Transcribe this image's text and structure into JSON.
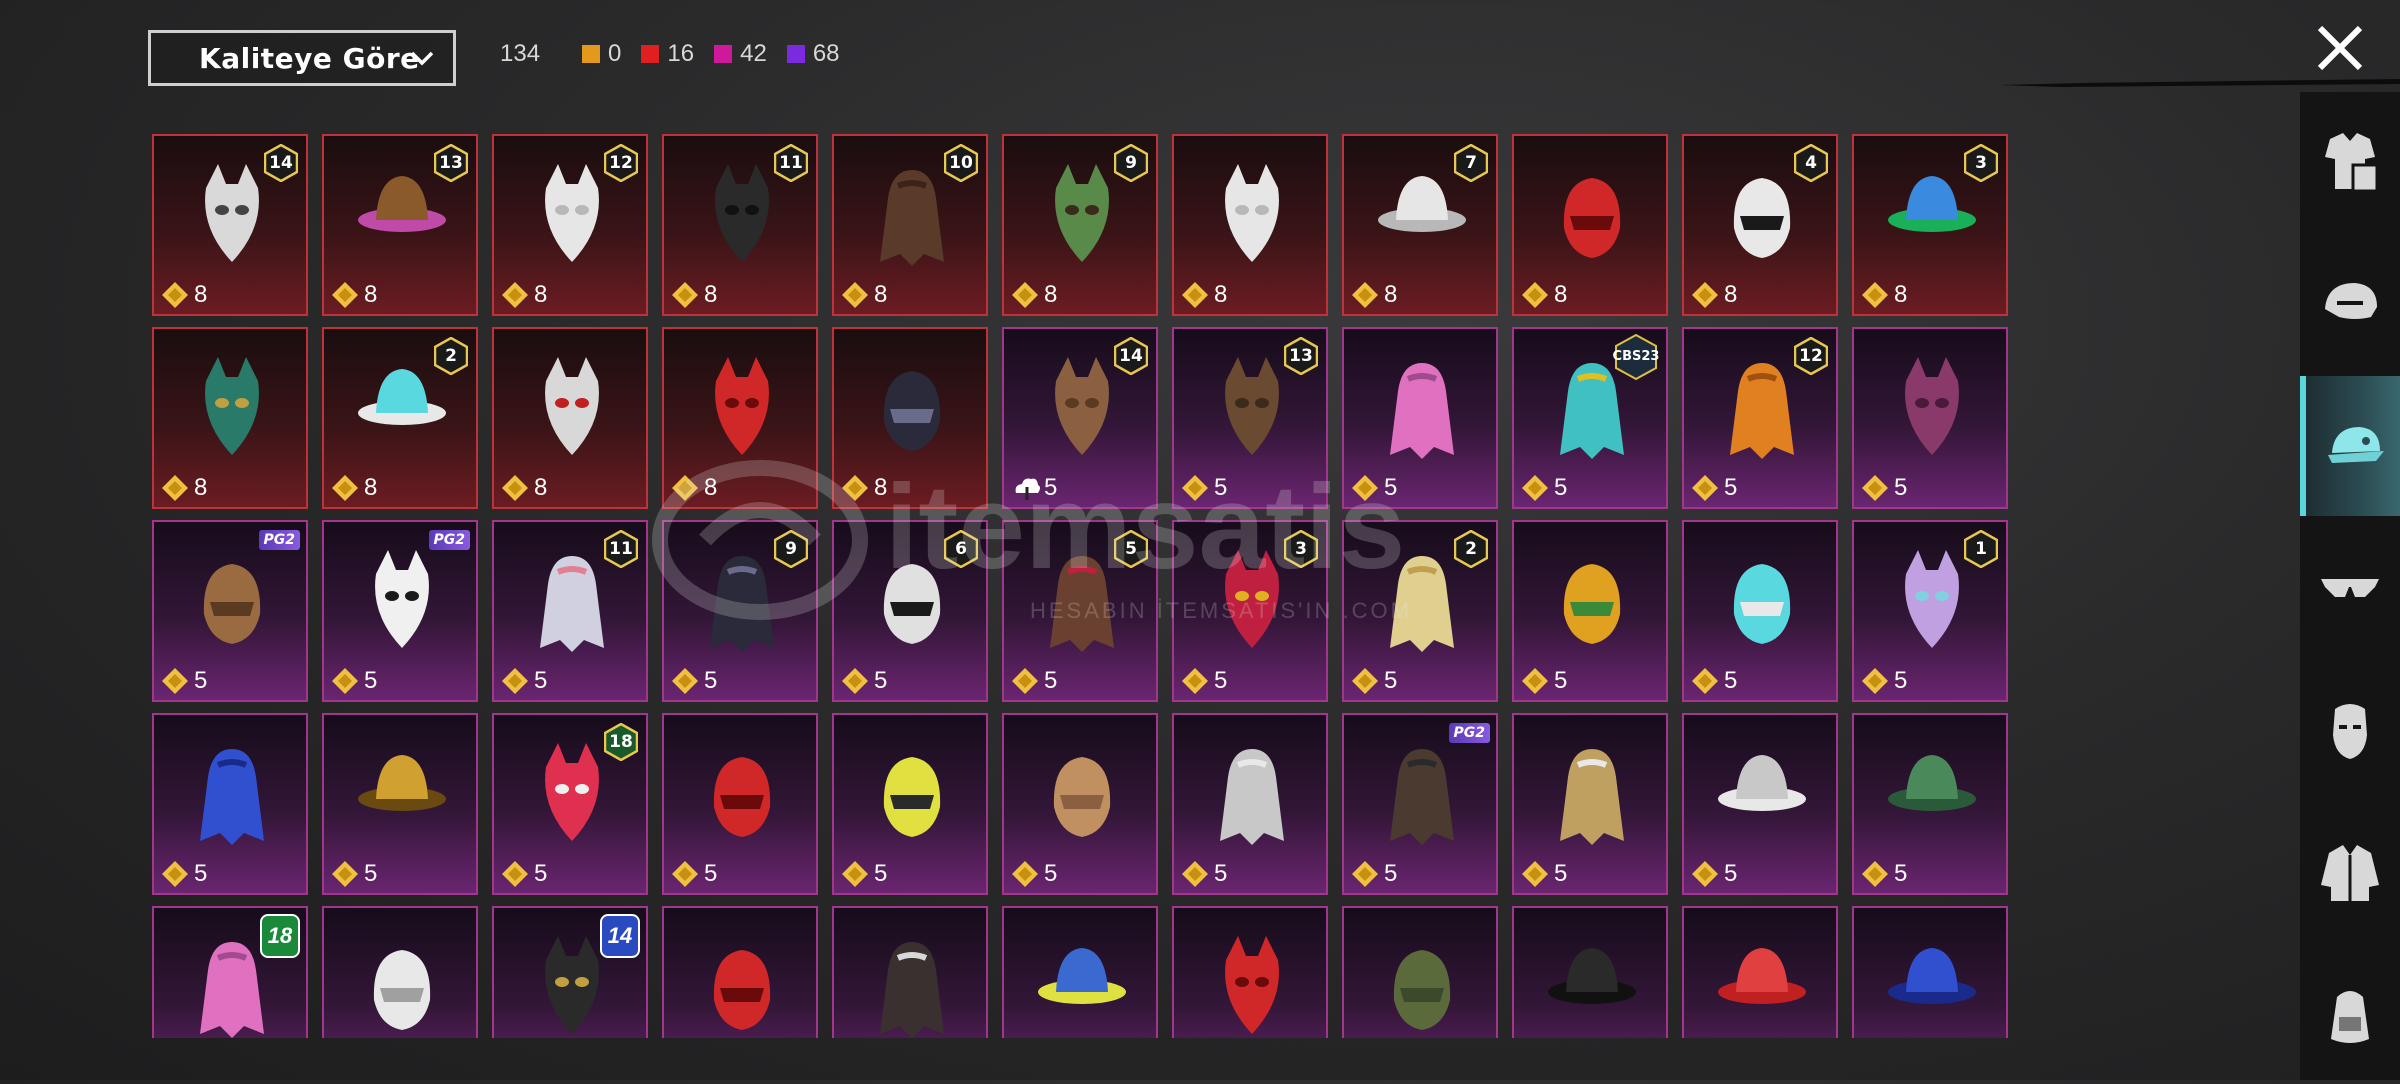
{
  "header": {
    "sort_label": "Kaliteye Göre",
    "total_count": "134",
    "quality_counts": [
      {
        "value": "0",
        "color": "#e39a1c"
      },
      {
        "value": "16",
        "color": "#e02020"
      },
      {
        "value": "42",
        "color": "#d0189a"
      },
      {
        "value": "68",
        "color": "#7b2ae0"
      }
    ],
    "close_icon": "close-icon"
  },
  "sidebar": {
    "tabs": [
      {
        "name": "clothing-icon",
        "active": false
      },
      {
        "name": "hat-mask-icon",
        "active": false
      },
      {
        "name": "cap-icon",
        "active": true
      },
      {
        "name": "glasses-icon",
        "active": false
      },
      {
        "name": "face-icon",
        "active": false
      },
      {
        "name": "jacket-icon",
        "active": false
      },
      {
        "name": "backpack-icon",
        "active": false
      }
    ]
  },
  "watermark": {
    "brand": "itemsatis",
    "tagline": "HESABIN İTEMSATIS'IN .COM"
  },
  "grid": {
    "rows": [
      [
        {
          "rarity": "red",
          "badge": "14",
          "points": "8",
          "icon": "wolf-mask-icon"
        },
        {
          "rarity": "red",
          "badge": "13",
          "points": "8",
          "icon": "flower-hat-hair-icon"
        },
        {
          "rarity": "red",
          "badge": "12",
          "points": "8",
          "icon": "white-hair-bow-icon"
        },
        {
          "rarity": "red",
          "badge": "11",
          "points": "8",
          "icon": "black-helmet-icon"
        },
        {
          "rarity": "red",
          "badge": "10",
          "points": "8",
          "icon": "braided-hair-icon"
        },
        {
          "rarity": "red",
          "badge": "9",
          "points": "8",
          "icon": "zombie-head-icon"
        },
        {
          "rarity": "red",
          "badge": "",
          "points": "8",
          "icon": "white-cowboy-hat-icon"
        },
        {
          "rarity": "red",
          "badge": "7",
          "points": "8",
          "icon": "white-hair-icon"
        },
        {
          "rarity": "red",
          "badge": "",
          "points": "8",
          "icon": "red-helmet-icon"
        },
        {
          "rarity": "red",
          "badge": "4",
          "points": "8",
          "icon": "snowman-hat-icon"
        },
        {
          "rarity": "red",
          "badge": "3",
          "points": "8",
          "icon": "joker-mask-icon"
        }
      ],
      [
        {
          "rarity": "red",
          "badge": "",
          "points": "8",
          "icon": "dragon-helmet-icon"
        },
        {
          "rarity": "red",
          "badge": "2",
          "points": "8",
          "icon": "cyan-bucket-hat-icon"
        },
        {
          "rarity": "red",
          "badge": "",
          "points": "8",
          "icon": "oni-mask-icon"
        },
        {
          "rarity": "red",
          "badge": "",
          "points": "8",
          "icon": "red-visor-helmet-icon"
        },
        {
          "rarity": "red",
          "badge": "",
          "points": "8",
          "icon": "dark-horned-helmet-icon"
        },
        {
          "rarity": "purple",
          "badge": "14",
          "points": "5",
          "icon": "brown-hair-flower-icon",
          "cloud": true
        },
        {
          "rarity": "purple",
          "badge": "13",
          "points": "5",
          "icon": "aviator-cap-icon"
        },
        {
          "rarity": "purple",
          "badge": "",
          "points": "5",
          "icon": "pink-pigtails-icon"
        },
        {
          "rarity": "purple",
          "badge": "CBS23",
          "points": "5",
          "icon": "cat-headphones-icon"
        },
        {
          "rarity": "purple",
          "badge": "12",
          "points": "5",
          "icon": "orange-twintails-icon"
        },
        {
          "rarity": "purple",
          "badge": "",
          "points": "5",
          "icon": "horned-hood-icon"
        }
      ],
      [
        {
          "rarity": "purple",
          "badge": "PG2",
          "points": "5",
          "icon": "bear-mask-icon"
        },
        {
          "rarity": "purple",
          "badge": "PG2",
          "points": "5",
          "icon": "panda-mask-icon"
        },
        {
          "rarity": "purple",
          "badge": "11",
          "points": "5",
          "icon": "veil-headband-icon"
        },
        {
          "rarity": "purple",
          "badge": "9",
          "points": "5",
          "icon": "dark-long-hair-icon"
        },
        {
          "rarity": "purple",
          "badge": "6",
          "points": "5",
          "icon": "knight-helmet-icon"
        },
        {
          "rarity": "purple",
          "badge": "5",
          "points": "5",
          "icon": "bow-pigtails-icon"
        },
        {
          "rarity": "purple",
          "badge": "3",
          "points": "5",
          "icon": "jester-hat-icon"
        },
        {
          "rarity": "purple",
          "badge": "2",
          "points": "5",
          "icon": "blonde-bandana-icon"
        },
        {
          "rarity": "purple",
          "badge": "",
          "points": "5",
          "icon": "feather-headdress-icon"
        },
        {
          "rarity": "purple",
          "badge": "",
          "points": "5",
          "icon": "cyan-mohawk-icon"
        },
        {
          "rarity": "purple",
          "badge": "1",
          "points": "5",
          "icon": "pastel-twintails-icon"
        }
      ],
      [
        {
          "rarity": "purple",
          "badge": "",
          "points": "5",
          "icon": "blue-wolf-mask-icon"
        },
        {
          "rarity": "purple",
          "badge": "",
          "points": "5",
          "icon": "gold-helmet-icon"
        },
        {
          "rarity": "purple",
          "badge": "18",
          "points": "5",
          "icon": "uncle-sam-hat-icon"
        },
        {
          "rarity": "purple",
          "badge": "",
          "points": "5",
          "icon": "red-cap-hair-icon"
        },
        {
          "rarity": "purple",
          "badge": "",
          "points": "5",
          "icon": "yellow-bucket-hat-icon"
        },
        {
          "rarity": "purple",
          "badge": "",
          "points": "5",
          "icon": "straw-hat-icon"
        },
        {
          "rarity": "purple",
          "badge": "",
          "points": "5",
          "icon": "silver-hood-icon"
        },
        {
          "rarity": "purple",
          "badge": "PG2",
          "points": "5",
          "icon": "gas-mask-icon"
        },
        {
          "rarity": "purple",
          "badge": "",
          "points": "5",
          "icon": "feathered-crown-icon"
        },
        {
          "rarity": "purple",
          "badge": "",
          "points": "5",
          "icon": "silver-ponytail-icon"
        },
        {
          "rarity": "purple",
          "badge": "",
          "points": "5",
          "icon": "green-hood-icon"
        }
      ],
      [
        {
          "rarity": "purple",
          "badge": "18",
          "points": "",
          "icon": "pink-headphones-icon"
        },
        {
          "rarity": "purple",
          "badge": "",
          "points": "",
          "icon": "lion-mask-icon"
        },
        {
          "rarity": "purple",
          "badge": "14",
          "points": "",
          "icon": "officer-cap-icon"
        },
        {
          "rarity": "purple",
          "badge": "",
          "points": "",
          "icon": "red-wizard-hat-icon"
        },
        {
          "rarity": "purple",
          "badge": "",
          "points": "",
          "icon": "dreadlock-mask-icon"
        },
        {
          "rarity": "purple",
          "badge": "",
          "points": "",
          "icon": "ski-goggles-icon"
        },
        {
          "rarity": "purple",
          "badge": "",
          "points": "",
          "icon": "red-hair-cap-icon"
        },
        {
          "rarity": "purple",
          "badge": "",
          "points": "",
          "icon": "army-helmet-icon"
        },
        {
          "rarity": "purple",
          "badge": "",
          "points": "",
          "icon": "black-beanie-icon"
        },
        {
          "rarity": "purple",
          "badge": "",
          "points": "",
          "icon": "crab-hat-icon"
        },
        {
          "rarity": "purple",
          "badge": "",
          "points": "",
          "icon": "blue-moto-helmet-icon"
        }
      ]
    ]
  }
}
